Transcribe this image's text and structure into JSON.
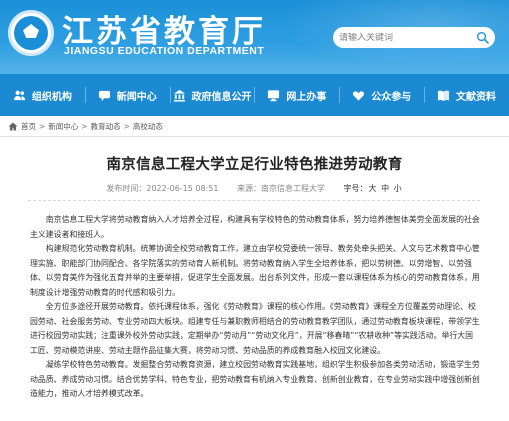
{
  "header": {
    "title": "江苏省教育厅",
    "subtitle": "JIANGSU EDUCATION DEPARTMENT",
    "search_placeholder": "请输入关键词"
  },
  "nav": {
    "items": [
      {
        "label": "组织机构",
        "icon": "group-icon"
      },
      {
        "label": "新闻中心",
        "icon": "chat-icon"
      },
      {
        "label": "政府信息公开",
        "icon": "building-icon"
      },
      {
        "label": "网上办事",
        "icon": "monitor-icon"
      },
      {
        "label": "公众参与",
        "icon": "heart-icon"
      },
      {
        "label": "文献资料",
        "icon": "book-icon"
      }
    ]
  },
  "breadcrumb": [
    "首页",
    "新闻中心",
    "教育动态",
    "高校动态"
  ],
  "article": {
    "title": "南京信息工程大学立足行业特色推进劳动教育",
    "time": "发布时间：2022-06-15 08:51",
    "source": "来源：南京信息工程大学",
    "font_size_label": "字号：",
    "font_sizes": [
      "大",
      "中",
      "小"
    ],
    "paragraphs": [
      "南京信息工程大学将劳动教育纳入人才培养全过程，构建具有学校特色的劳动教育体系，努力培养德智体美劳全面发展的社会主义建设者和接班人。",
      "构建规范化劳动教育机制。统筹协调全校劳动教育工作，建立由学校党委统一领导、教务处牵头把关、人文与艺术教育中心管理实施、职能部门协同配合、各学院落实的劳动育人新机制。将劳动教育纳入学生全培养体系，把以劳树德、以劳增智、以劳强体、以劳育美作为强化五育并举的主要举措，促进学生全面发展。出台系列文件，形成一套以课程体系为核心的劳动教育体系，用制度设计增强劳动教育的时代感和吸引力。",
      "全方位多途径开展劳动教育。依托课程体系，强化《劳动教育》课程的核心作用。《劳动教育》课程全方位覆盖劳动理论、校园劳动、社会服务劳动、专业劳动四大板块。组建专任与兼职教师相结合的劳动教育教学团队，通过劳动教育板块课程，带领学生进行校园劳动实践；注重课外校外劳动实践，定期举办“劳动月”“劳动文化月”，开展“移春晴”“农耕收种”等实践活动。举行大国工匠、劳动模范讲座、劳动主题作品征集大赛，将劳动习惯、劳动品质的养成教育融入校园文化建设。",
      "凝练学校特色劳动教育。发掘整合劳动教育资源，建立校园劳动教育实践基地，组织学生积极参加各类劳动活动，锻造学生劳动品质、养成劳动习惯。结合优势学科、特色专业，把劳动教育有机纳入专业教育、创新创业教育，在专业劳动实践中增强创新创造能力，推动人才培养模式改革。"
    ]
  },
  "colors": {
    "banner": "#1a8fd8",
    "nav": "#1b8ad3",
    "title_text": "#222222"
  }
}
